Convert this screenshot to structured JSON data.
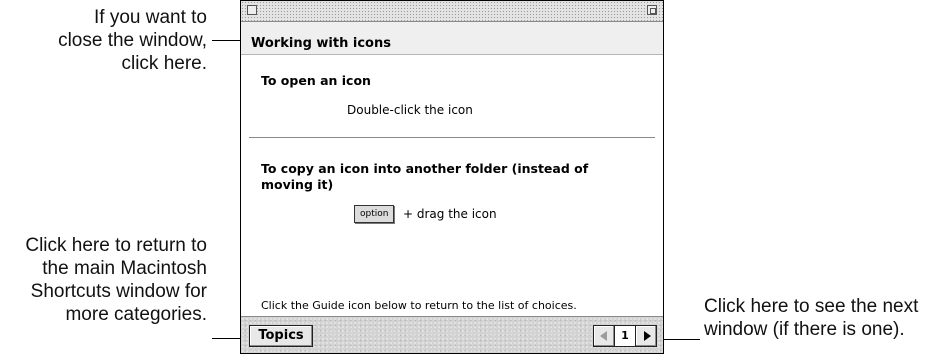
{
  "callouts": {
    "close": [
      "If you want to",
      "close the window,",
      "click here."
    ],
    "topics": [
      "Click here to return to",
      "the main Macintosh",
      "Shortcuts window for",
      "more categories."
    ],
    "next": [
      "Click here to see the next",
      "window (if there is one)."
    ]
  },
  "window": {
    "header_title": "Working with icons",
    "sections": [
      {
        "heading": "To open an icon",
        "body": "Double-click the icon"
      },
      {
        "heading_lines": [
          "To copy an icon into another folder (instead of",
          "moving it)"
        ],
        "key": "option",
        "rest": "+  drag the icon"
      }
    ],
    "footer_note": "Click the Guide icon below to return to the list of choices.",
    "topics_label": "Topics",
    "page_number": "1"
  }
}
